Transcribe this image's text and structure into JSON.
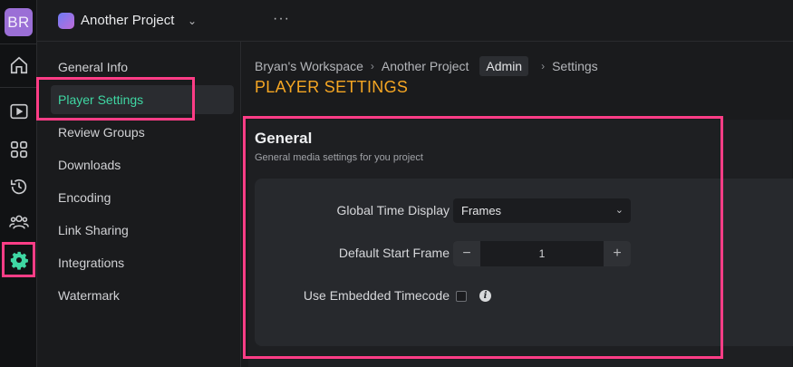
{
  "user": {
    "initials": "BR",
    "avatar_color": "#9b6fd6"
  },
  "rail": {
    "icons": [
      "home-icon",
      "play-icon",
      "grid-icon",
      "history-icon",
      "team-icon",
      "settings-icon"
    ],
    "active": "settings-icon",
    "active_color": "#3fd7a3"
  },
  "project": {
    "name": "Another Project",
    "more": "···"
  },
  "settings_nav": {
    "items": [
      {
        "label": "General Info"
      },
      {
        "label": "Player Settings"
      },
      {
        "label": "Review Groups"
      },
      {
        "label": "Downloads"
      },
      {
        "label": "Encoding"
      },
      {
        "label": "Link Sharing"
      },
      {
        "label": "Integrations"
      },
      {
        "label": "Watermark"
      }
    ],
    "active": "Player Settings",
    "active_color": "#3fd7a3"
  },
  "breadcrumb": {
    "workspace": "Bryan's Workspace",
    "project": "Another Project",
    "badge": "Admin",
    "current": "Settings"
  },
  "page": {
    "title": "PLAYER SETTINGS",
    "title_color": "#f5a623"
  },
  "general": {
    "title": "General",
    "subtitle": "General media settings for you project",
    "time_display_label": "Global Time Display",
    "time_display_value": "Frames",
    "start_frame_label": "Default Start Frame",
    "start_frame_value": "1",
    "start_frame_minus": "−",
    "start_frame_plus": "+",
    "timecode_label": "Use Embedded Timecode",
    "timecode_checked": false,
    "info_glyph": "i"
  },
  "highlight_color": "#ff3d86"
}
